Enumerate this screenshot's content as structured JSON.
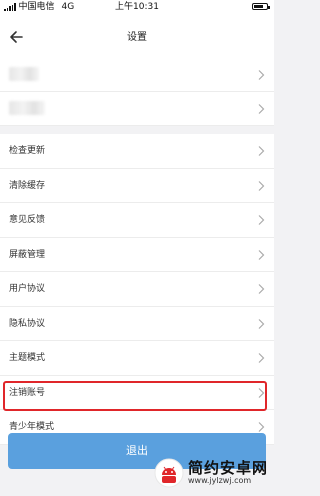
{
  "status_bar": {
    "carrier": "中国电信",
    "network": "4G",
    "time": "上午10:31"
  },
  "nav": {
    "title": "设置",
    "back_icon": "arrow-left-icon"
  },
  "settings": {
    "account_rows_blurred": 2,
    "items": [
      {
        "label": "检查更新"
      },
      {
        "label": "清除缓存"
      },
      {
        "label": "意见反馈"
      },
      {
        "label": "屏蔽管理"
      },
      {
        "label": "用户协议"
      },
      {
        "label": "隐私协议"
      },
      {
        "label": "主题模式"
      },
      {
        "label": "注销账号",
        "highlighted": true
      },
      {
        "label": "青少年模式"
      }
    ]
  },
  "logout_label": "退出",
  "watermark": {
    "name": "简约安卓网",
    "url": "www.jylzwj.com"
  },
  "colors": {
    "accent": "#5aa0de",
    "highlight_border": "#e0262a",
    "background": "#f2f2f4"
  }
}
